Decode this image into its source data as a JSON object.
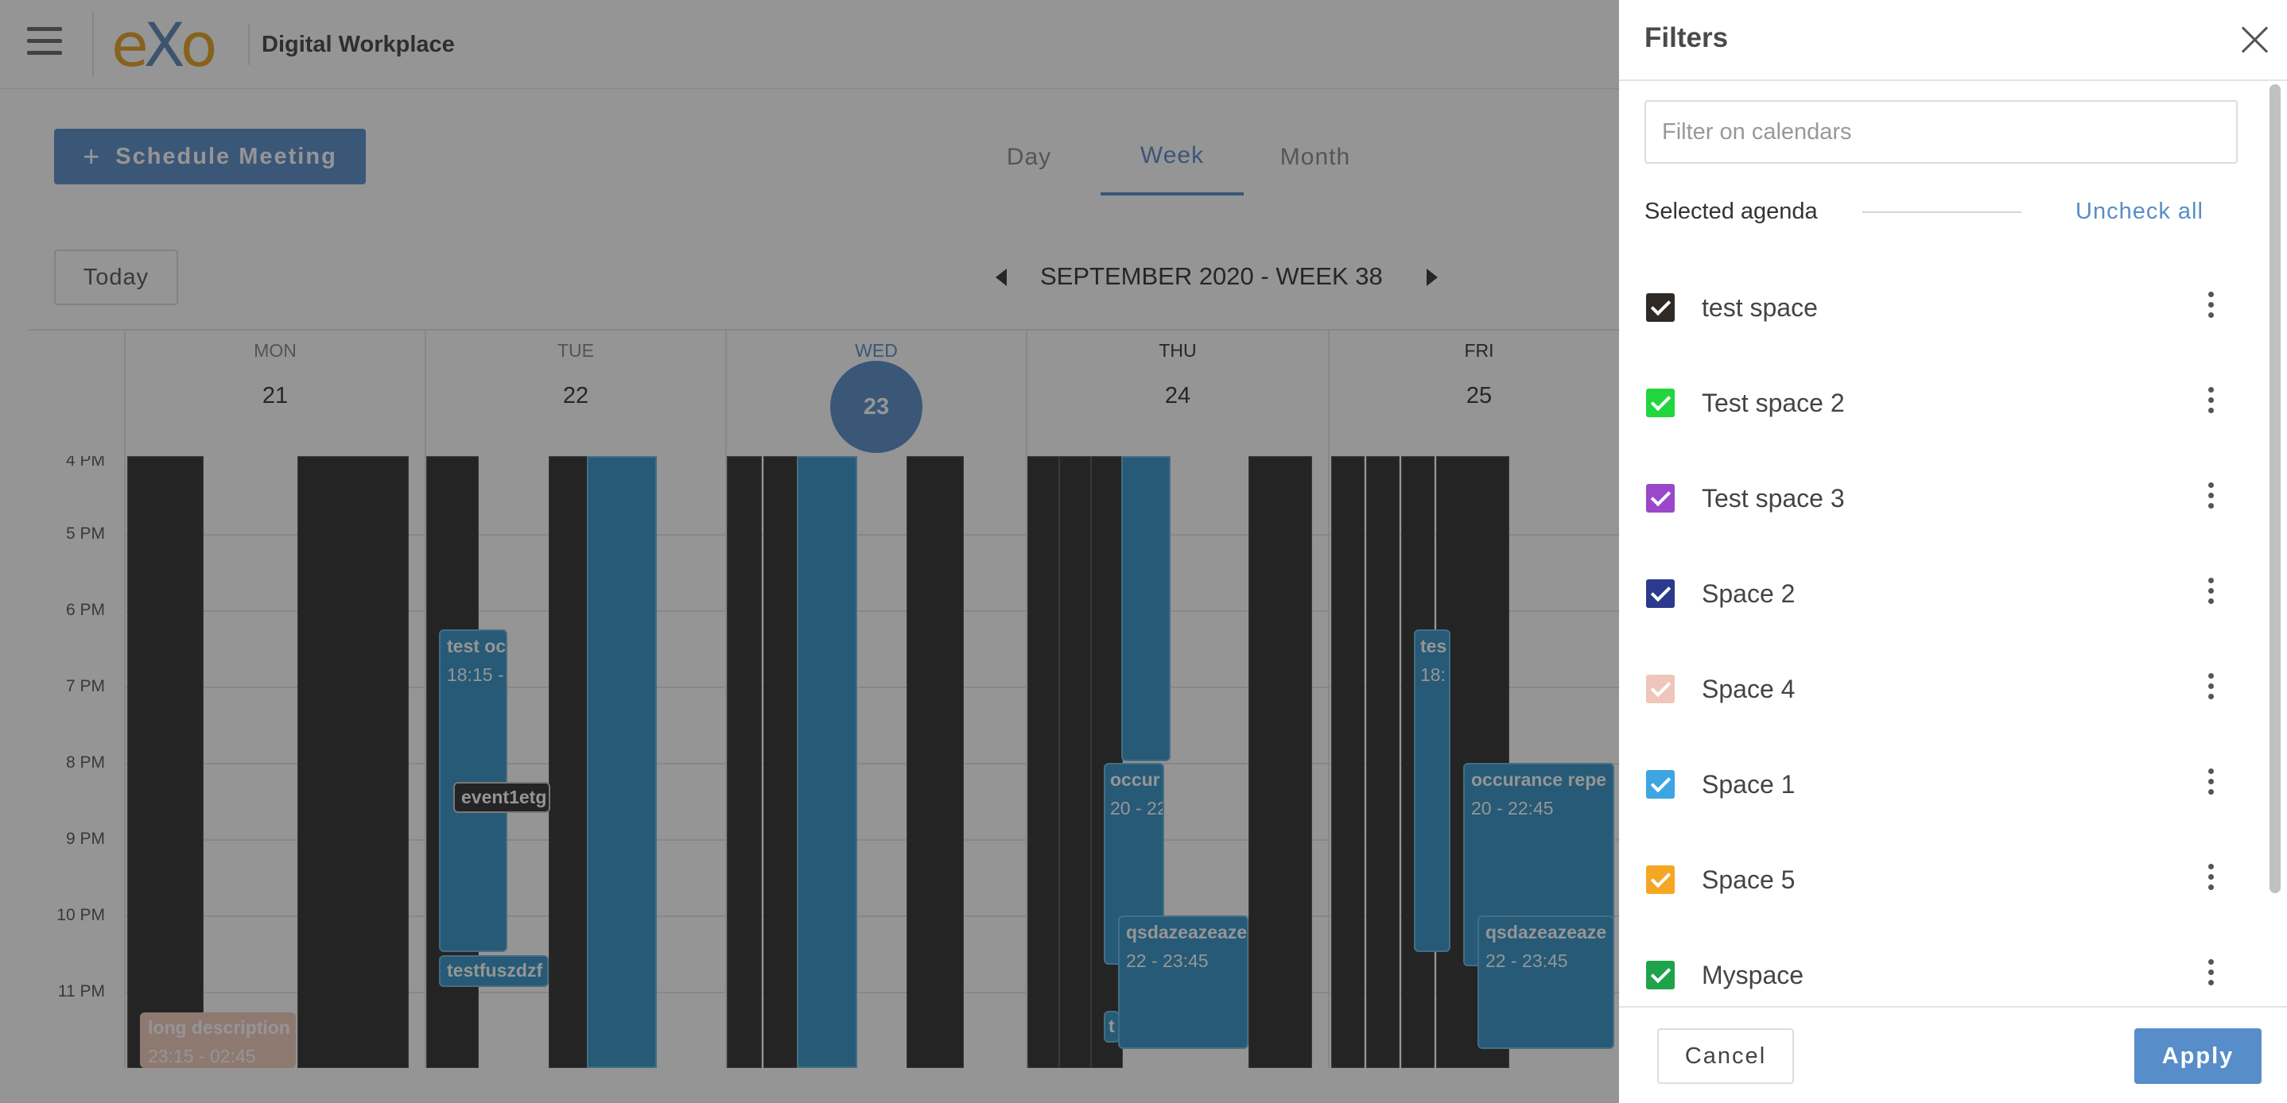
{
  "app": {
    "title": "Digital Workplace",
    "logo_text": "eXo"
  },
  "toolbar": {
    "schedule_label": "Schedule Meeting",
    "tabs": [
      {
        "label": "Day",
        "active": false
      },
      {
        "label": "Week",
        "active": true
      },
      {
        "label": "Month",
        "active": false
      }
    ]
  },
  "calendar": {
    "today_label": "Today",
    "week_label": "SEPTEMBER 2020 - WEEK 38",
    "days": [
      {
        "name": "MON",
        "number": "21"
      },
      {
        "name": "TUE",
        "number": "22"
      },
      {
        "name": "WED",
        "number": "23",
        "current": true
      },
      {
        "name": "THU",
        "number": "24"
      },
      {
        "name": "FRI",
        "number": "25"
      }
    ],
    "hours": [
      "4 PM",
      "5 PM",
      "6 PM",
      "7 PM",
      "8 PM",
      "9 PM",
      "10 PM",
      "11 PM"
    ],
    "events": {
      "tue_test": {
        "title": "test oc",
        "time": "18:15 -"
      },
      "tue_chip": {
        "title": "event1etg"
      },
      "tue_bottom": {
        "title": "testfuszdzf"
      },
      "thu_occur": {
        "title": "occur",
        "time": "20 - 22"
      },
      "thu_qsd": {
        "title": "qsdazeazeaze",
        "time": "22 - 23:45"
      },
      "thu_small": {
        "title": "t"
      },
      "fri_test": {
        "title": "tes",
        "time": "18:"
      },
      "fri_occur": {
        "title": "occurance repe",
        "time": "20 - 22:45"
      },
      "fri_qsd": {
        "title": "qsdazeazeaze",
        "time": "22 - 23:45"
      },
      "mon_long": {
        "title": "long description",
        "time": "23:15 - 02:45"
      }
    }
  },
  "filters": {
    "title": "Filters",
    "search_placeholder": "Filter on calendars",
    "selected_label": "Selected agenda",
    "uncheck_all_label": "Uncheck all",
    "agendas": [
      {
        "name": "test space",
        "color": "#2f2a25",
        "checked": true
      },
      {
        "name": "Test space 2",
        "color": "#22d63f",
        "checked": true
      },
      {
        "name": "Test space 3",
        "color": "#9a48c9",
        "checked": true
      },
      {
        "name": "Space 2",
        "color": "#2b3a8c",
        "checked": true
      },
      {
        "name": "Space 4",
        "color": "#eec6bb",
        "checked": true
      },
      {
        "name": "Space 1",
        "color": "#3ea5e2",
        "checked": true
      },
      {
        "name": "Space 5",
        "color": "#f5a623",
        "checked": true
      },
      {
        "name": "Myspace",
        "color": "#1ea34a",
        "checked": true
      }
    ],
    "cancel_label": "Cancel",
    "apply_label": "Apply"
  },
  "colors": {
    "accent": "#578dc9",
    "dark_event": "#2f2f2f",
    "blue_event": "#3393c6"
  }
}
